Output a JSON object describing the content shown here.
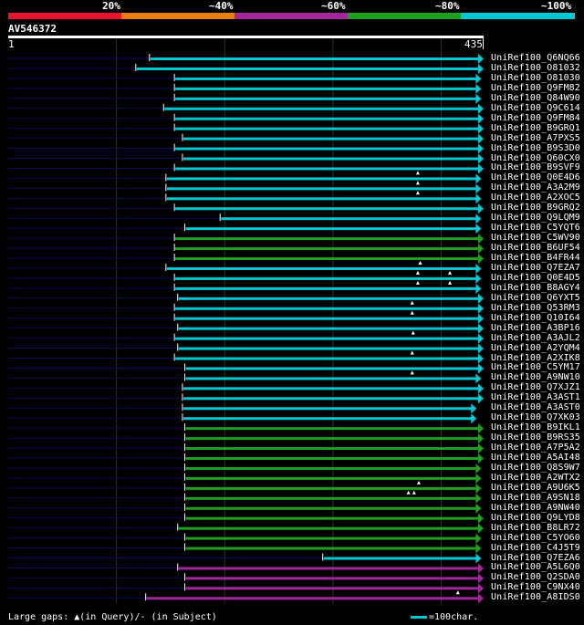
{
  "legend": {
    "labels": [
      "20%",
      "~40%",
      "~60%",
      "~80%",
      "~100%"
    ],
    "colors": [
      "#e8142d",
      "#e87d14",
      "#a0289b",
      "#1ea01e",
      "#00c8d2"
    ]
  },
  "query": {
    "name": "AV546372",
    "start": "1",
    "end": "435",
    "length": 435
  },
  "hits": [
    {
      "name": "UniRef100_Q6NQ66",
      "start": 0.3,
      "end": 1.0,
      "color": "#00c8d2",
      "marks": []
    },
    {
      "name": "UniRef100_O81032",
      "start": 0.271,
      "end": 1.0,
      "color": "#00c8d2",
      "marks": []
    },
    {
      "name": "UniRef100_O81030",
      "start": 0.353,
      "end": 0.995,
      "color": "#00c8d2",
      "marks": []
    },
    {
      "name": "UniRef100_Q9FM82",
      "start": 0.353,
      "end": 0.995,
      "color": "#00c8d2",
      "marks": []
    },
    {
      "name": "UniRef100_Q84W90",
      "start": 0.353,
      "end": 0.995,
      "color": "#00c8d2",
      "marks": []
    },
    {
      "name": "UniRef100_Q9C614",
      "start": 0.33,
      "end": 1.0,
      "color": "#00c8d2",
      "marks": []
    },
    {
      "name": "UniRef100_Q9FM84",
      "start": 0.353,
      "end": 1.0,
      "color": "#00c8d2",
      "marks": []
    },
    {
      "name": "UniRef100_B9GRQ1",
      "start": 0.353,
      "end": 1.0,
      "color": "#00c8d2",
      "marks": []
    },
    {
      "name": "UniRef100_A7PXS5",
      "start": 0.37,
      "end": 1.0,
      "color": "#00c8d2",
      "marks": []
    },
    {
      "name": "UniRef100_B9S3D0",
      "start": 0.353,
      "end": 1.0,
      "color": "#00c8d2",
      "marks": []
    },
    {
      "name": "UniRef100_Q60CX0",
      "start": 0.37,
      "end": 1.0,
      "color": "#00c8d2",
      "marks": []
    },
    {
      "name": "UniRef100_B9SVF9",
      "start": 0.353,
      "end": 1.0,
      "color": "#00c8d2",
      "marks": []
    },
    {
      "name": "UniRef100_Q0E4D6",
      "start": 0.335,
      "end": 0.995,
      "color": "#00c8d2",
      "marks": [
        0.87
      ]
    },
    {
      "name": "UniRef100_A3A2M9",
      "start": 0.335,
      "end": 0.995,
      "color": "#00c8d2",
      "marks": [
        0.87
      ]
    },
    {
      "name": "UniRef100_A2XOC5",
      "start": 0.335,
      "end": 0.995,
      "color": "#00c8d2",
      "marks": [
        0.87
      ]
    },
    {
      "name": "UniRef100_B9GRQ2",
      "start": 0.353,
      "end": 1.0,
      "color": "#00c8d2",
      "marks": []
    },
    {
      "name": "UniRef100_Q9LQM9",
      "start": 0.45,
      "end": 0.995,
      "color": "#00c8d2",
      "marks": []
    },
    {
      "name": "UniRef100_C5YQT6",
      "start": 0.375,
      "end": 0.995,
      "color": "#00c8d2",
      "marks": []
    },
    {
      "name": "UniRef100_C5WV90",
      "start": 0.353,
      "end": 1.0,
      "color": "#1ea01e",
      "marks": []
    },
    {
      "name": "UniRef100_B6UF54",
      "start": 0.353,
      "end": 1.0,
      "color": "#1ea01e",
      "marks": []
    },
    {
      "name": "UniRef100_B4FR44",
      "start": 0.353,
      "end": 1.0,
      "color": "#1ea01e",
      "marks": []
    },
    {
      "name": "UniRef100_Q7EZA7",
      "start": 0.335,
      "end": 0.995,
      "color": "#00c8d2",
      "marks": [
        0.875
      ]
    },
    {
      "name": "UniRef100_Q0E4D5",
      "start": 0.353,
      "end": 0.995,
      "color": "#00c8d2",
      "marks": [
        0.87,
        0.938
      ]
    },
    {
      "name": "UniRef100_B8AGY4",
      "start": 0.353,
      "end": 0.995,
      "color": "#00c8d2",
      "marks": [
        0.87,
        0.938
      ]
    },
    {
      "name": "UniRef100_Q6YXT5",
      "start": 0.36,
      "end": 1.0,
      "color": "#00c8d2",
      "marks": []
    },
    {
      "name": "UniRef100_Q53RM3",
      "start": 0.353,
      "end": 1.0,
      "color": "#00c8d2",
      "marks": [
        0.858
      ]
    },
    {
      "name": "UniRef100_Q10I64",
      "start": 0.353,
      "end": 1.0,
      "color": "#00c8d2",
      "marks": [
        0.858
      ]
    },
    {
      "name": "UniRef100_A3BP16",
      "start": 0.36,
      "end": 1.0,
      "color": "#00c8d2",
      "marks": []
    },
    {
      "name": "UniRef100_A3AJL2",
      "start": 0.353,
      "end": 1.0,
      "color": "#00c8d2",
      "marks": [
        0.86
      ]
    },
    {
      "name": "UniRef100_A2YQM4",
      "start": 0.36,
      "end": 1.0,
      "color": "#00c8d2",
      "marks": []
    },
    {
      "name": "UniRef100_A2XIK8",
      "start": 0.353,
      "end": 1.0,
      "color": "#00c8d2",
      "marks": [
        0.858
      ]
    },
    {
      "name": "UniRef100_C5YM17",
      "start": 0.375,
      "end": 1.0,
      "color": "#00c8d2",
      "marks": []
    },
    {
      "name": "UniRef100_A9NW10",
      "start": 0.375,
      "end": 0.995,
      "color": "#00c8d2",
      "marks": [
        0.858
      ]
    },
    {
      "name": "UniRef100_Q7XJZ1",
      "start": 0.37,
      "end": 1.0,
      "color": "#00c8d2",
      "marks": []
    },
    {
      "name": "UniRef100_A3AST1",
      "start": 0.37,
      "end": 1.0,
      "color": "#00c8d2",
      "marks": []
    },
    {
      "name": "UniRef100_A3AST0",
      "start": 0.37,
      "end": 0.985,
      "color": "#00c8d2",
      "marks": []
    },
    {
      "name": "UniRef100_Q7XK03",
      "start": 0.37,
      "end": 0.985,
      "color": "#00c8d2",
      "marks": []
    },
    {
      "name": "UniRef100_B9IKL1",
      "start": 0.375,
      "end": 1.0,
      "color": "#1ea01e",
      "marks": []
    },
    {
      "name": "UniRef100_B9RS35",
      "start": 0.375,
      "end": 1.0,
      "color": "#1ea01e",
      "marks": []
    },
    {
      "name": "UniRef100_A7P5A2",
      "start": 0.375,
      "end": 1.0,
      "color": "#1ea01e",
      "marks": []
    },
    {
      "name": "UniRef100_A5AI48",
      "start": 0.375,
      "end": 1.0,
      "color": "#1ea01e",
      "marks": []
    },
    {
      "name": "UniRef100_Q8S9W7",
      "start": 0.375,
      "end": 0.995,
      "color": "#1ea01e",
      "marks": []
    },
    {
      "name": "UniRef100_A2WTX2",
      "start": 0.375,
      "end": 0.995,
      "color": "#1ea01e",
      "marks": []
    },
    {
      "name": "UniRef100_A9U6K5",
      "start": 0.375,
      "end": 0.995,
      "color": "#1ea01e",
      "marks": [
        0.872
      ]
    },
    {
      "name": "UniRef100_A9SN18",
      "start": 0.375,
      "end": 0.995,
      "color": "#1ea01e",
      "marks": [
        0.85,
        0.862
      ]
    },
    {
      "name": "UniRef100_A9NW40",
      "start": 0.375,
      "end": 0.995,
      "color": "#1ea01e",
      "marks": []
    },
    {
      "name": "UniRef100_Q9LYD8",
      "start": 0.375,
      "end": 1.0,
      "color": "#1ea01e",
      "marks": []
    },
    {
      "name": "UniRef100_B8LR72",
      "start": 0.36,
      "end": 1.0,
      "color": "#1ea01e",
      "marks": []
    },
    {
      "name": "UniRef100_C5YO60",
      "start": 0.375,
      "end": 0.995,
      "color": "#1ea01e",
      "marks": []
    },
    {
      "name": "UniRef100_C4J5T9",
      "start": 0.375,
      "end": 0.995,
      "color": "#1ea01e",
      "marks": []
    },
    {
      "name": "UniRef100_Q7EZA6",
      "start": 0.668,
      "end": 0.995,
      "color": "#00c8d2",
      "marks": []
    },
    {
      "name": "UniRef100_A5L6Q0",
      "start": 0.36,
      "end": 1.0,
      "color": "#a0289b",
      "marks": []
    },
    {
      "name": "UniRef100_Q2SDA0",
      "start": 0.375,
      "end": 1.0,
      "color": "#a0289b",
      "marks": []
    },
    {
      "name": "UniRef100_C9NX40",
      "start": 0.375,
      "end": 1.0,
      "color": "#a0289b",
      "marks": []
    },
    {
      "name": "UniRef100_A8IDS0",
      "start": 0.292,
      "end": 1.0,
      "color": "#a0289b",
      "marks": [
        0.955
      ]
    }
  ],
  "footer": {
    "text": "Large gaps: ▲(in Query)/- (in Subject)"
  },
  "scale": {
    "text": "=100char."
  },
  "colors": {
    "grid": "#1e3c1e",
    "left_trail": "#0a0a5a",
    "arrow": "#00c8d2",
    "background": "#000000"
  }
}
